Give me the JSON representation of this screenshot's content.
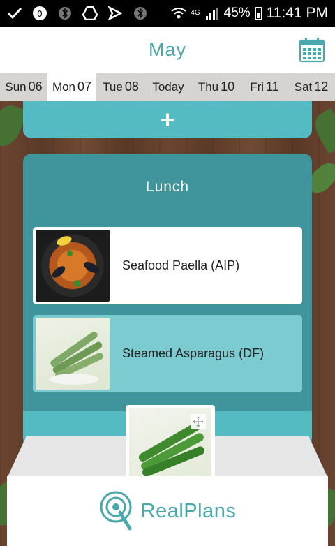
{
  "status_bar": {
    "network": "4G",
    "battery_percent": "45%",
    "time": "11:41 PM",
    "icons": [
      "check-icon",
      "voicemail-icon",
      "bluetooth-icon",
      "drive-icon",
      "download-icon",
      "bluetooth-icon",
      "wifi-icon",
      "signal-icon",
      "battery-icon"
    ]
  },
  "header": {
    "month": "May",
    "calendar_icon": "calendar-icon"
  },
  "days": [
    {
      "name": "Sun",
      "num": "06",
      "active": false
    },
    {
      "name": "Mon",
      "num": "07",
      "active": true
    },
    {
      "name": "Tue",
      "num": "08",
      "active": false
    },
    {
      "name": "Today",
      "num": "",
      "active": false
    },
    {
      "name": "Thu",
      "num": "10",
      "active": false
    },
    {
      "name": "Fri",
      "num": "11",
      "active": false
    },
    {
      "name": "Sat",
      "num": "12",
      "active": false
    }
  ],
  "add_button": {
    "label": "+"
  },
  "meal": {
    "title": "Lunch",
    "recipes": [
      {
        "name": "Seafood Paella (AIP)"
      },
      {
        "name": "Steamed Asparagus (DF)"
      }
    ]
  },
  "footer": {
    "brand": "RealPlans"
  },
  "colors": {
    "accent": "#49a8ab",
    "teal_light": "#55bbc3",
    "teal_dark": "#3f959b"
  }
}
